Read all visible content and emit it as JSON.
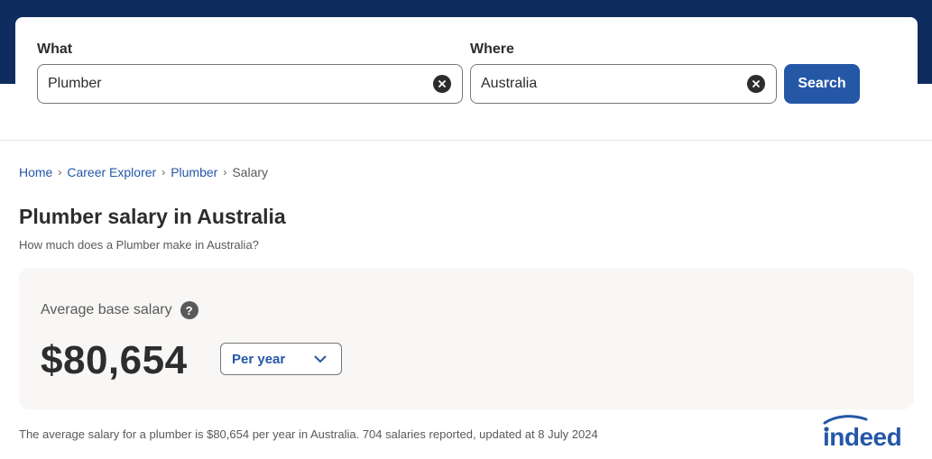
{
  "search": {
    "what_label": "What",
    "what_value": "Plumber",
    "where_label": "Where",
    "where_value": "Australia",
    "button_label": "Search"
  },
  "breadcrumb": {
    "items": [
      "Home",
      "Career Explorer",
      "Plumber"
    ],
    "current": "Salary"
  },
  "page": {
    "title": "Plumber salary in Australia",
    "subtitle": "How much does a Plumber make in Australia?"
  },
  "salary": {
    "label": "Average base salary",
    "help": "?",
    "value": "$80,654",
    "period": "Per year"
  },
  "footnote": "The average salary for a plumber is $80,654 per year in Australia.  704 salaries reported, updated at 8 July 2024",
  "brand": {
    "name": "indeed",
    "color": "#2557a7",
    "header_color": "#0e2c5e"
  }
}
